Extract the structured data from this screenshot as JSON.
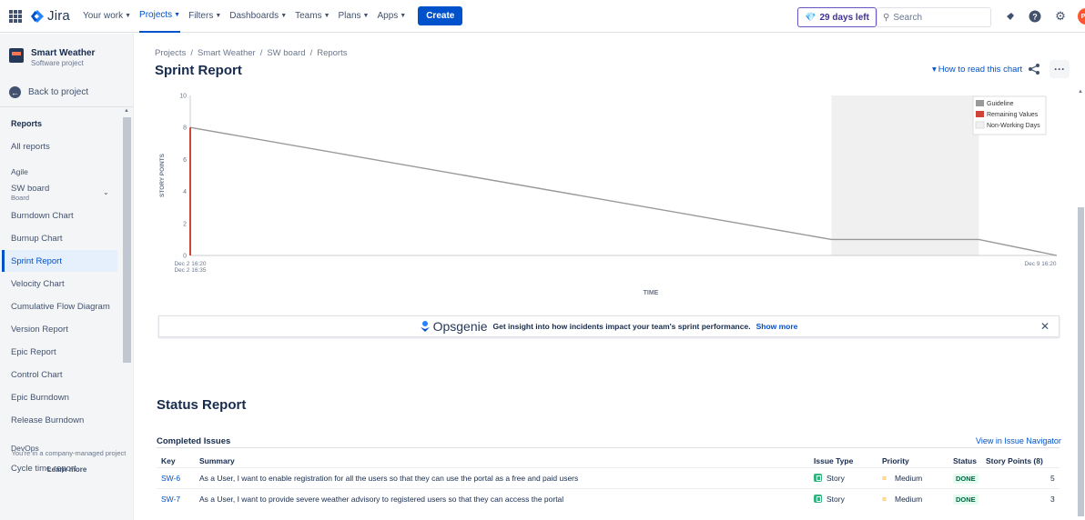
{
  "topnav": {
    "logo_text": "Jira",
    "items": [
      {
        "label": "Your work",
        "active": false
      },
      {
        "label": "Projects",
        "active": true
      },
      {
        "label": "Filters",
        "active": false
      },
      {
        "label": "Dashboards",
        "active": false
      },
      {
        "label": "Teams",
        "active": false
      },
      {
        "label": "Plans",
        "active": false
      },
      {
        "label": "Apps",
        "active": false
      }
    ],
    "create_label": "Create",
    "trial_label": "29 days left",
    "search_placeholder": "Search",
    "avatar_initials": "PM"
  },
  "sidebar": {
    "project_name": "Smart Weather",
    "project_type": "Software project",
    "back_label": "Back to project",
    "reports_heading": "Reports",
    "all_reports": "All reports",
    "agile_heading": "Agile",
    "board_name": "SW board",
    "board_sub": "Board",
    "items": [
      "Burndown Chart",
      "Burnup Chart",
      "Sprint Report",
      "Velocity Chart",
      "Cumulative Flow Diagram",
      "Version Report",
      "Epic Report",
      "Control Chart",
      "Epic Burndown",
      "Release Burndown"
    ],
    "selected": "Sprint Report",
    "devops_heading": "DevOps",
    "devops_items": [
      "Cycle time report"
    ],
    "company_note": "You're in a company-managed project",
    "learn_more": "Learn more"
  },
  "breadcrumb": [
    "Projects",
    "Smart Weather",
    "SW board",
    "Reports"
  ],
  "page_title": "Sprint Report",
  "how_to_read": "How to read this chart",
  "chart_data": {
    "type": "line",
    "ylabel": "STORY POINTS",
    "xlabel": "TIME",
    "ylim": [
      0,
      10
    ],
    "yticks": [
      0,
      2,
      4,
      6,
      8,
      10
    ],
    "x_tick_labels": [
      "Dec 2 16:20",
      "Dec 2 16:35",
      "Dec 9 16:20"
    ],
    "legend": [
      "Guideline",
      "Remaining Values",
      "Non-Working Days"
    ],
    "legend_position": "top-right",
    "series": [
      {
        "name": "Guideline",
        "color": "#999999",
        "points": [
          [
            0,
            8
          ],
          [
            0.74,
            1
          ],
          [
            0.91,
            1
          ],
          [
            1,
            0
          ]
        ]
      },
      {
        "name": "Remaining Values",
        "color": "#d04437",
        "points": [
          [
            0,
            0
          ],
          [
            0,
            8
          ]
        ]
      }
    ],
    "non_working_band": [
      0.74,
      0.91
    ]
  },
  "opsgenie": {
    "brand": "Opsgenie",
    "message": "Get insight into how incidents impact your team's sprint performance.",
    "link": "Show more"
  },
  "status_report_title": "Status Report",
  "completed_title": "Completed Issues",
  "view_in_navigator": "View in Issue Navigator",
  "table": {
    "headers": [
      "Key",
      "Summary",
      "Issue Type",
      "Priority",
      "Status",
      "Story Points (8)"
    ],
    "rows": [
      {
        "key": "SW-6",
        "summary": "As a User, I want to enable registration for all the users so that they can use the portal as a free and paid users",
        "type": "Story",
        "priority": "Medium",
        "status": "DONE",
        "points": "5"
      },
      {
        "key": "SW-7",
        "summary": "As a User, I want to provide severe weather advisory to registered users so that they can access the portal",
        "type": "Story",
        "priority": "Medium",
        "status": "DONE",
        "points": "3"
      }
    ]
  },
  "colors": {
    "brand": "#0052cc",
    "done_bg": "#e3fcef",
    "done_text": "#006644",
    "remaining": "#d04437",
    "guideline": "#999999"
  }
}
